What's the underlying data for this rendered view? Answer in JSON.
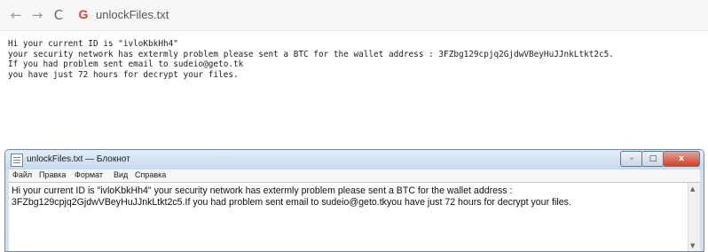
{
  "browser": {
    "back_icon": "←",
    "forward_icon": "→",
    "reload_icon": "C",
    "site_icon": "G",
    "url": "unlockFiles.txt"
  },
  "text_file": {
    "content": "Hi your current ID is \"ivloKbkHh4\"\nyour security network has extermly problem please sent a BTC for the wallet address : 3FZbg129cpjq2GjdwVBeyHuJJnkLtkt2c5.\nIf you had problem sent email to sudeio@geto.tk\nyou have just 72 hours for decrypt your files."
  },
  "notepad": {
    "title": "unlockFiles.txt — Блокнот",
    "menu": [
      "Файл",
      "Правка",
      "Формат",
      "Вид",
      "Справка"
    ],
    "content": "Hi your current ID is \"ivloKbkHh4\" your security network has extermly problem please sent a BTC for the wallet address : 3FZbg129cpjq2GjdwVBeyHuJJnkLtkt2c5.If you had problem sent email to sudeio@geto.tkyou have just 72 hours for decrypt your files.",
    "minimize_icon": "–",
    "maximize_icon": "□",
    "close_icon": "x",
    "scroll_up_icon": "▲",
    "scroll_down_icon": "▼"
  }
}
